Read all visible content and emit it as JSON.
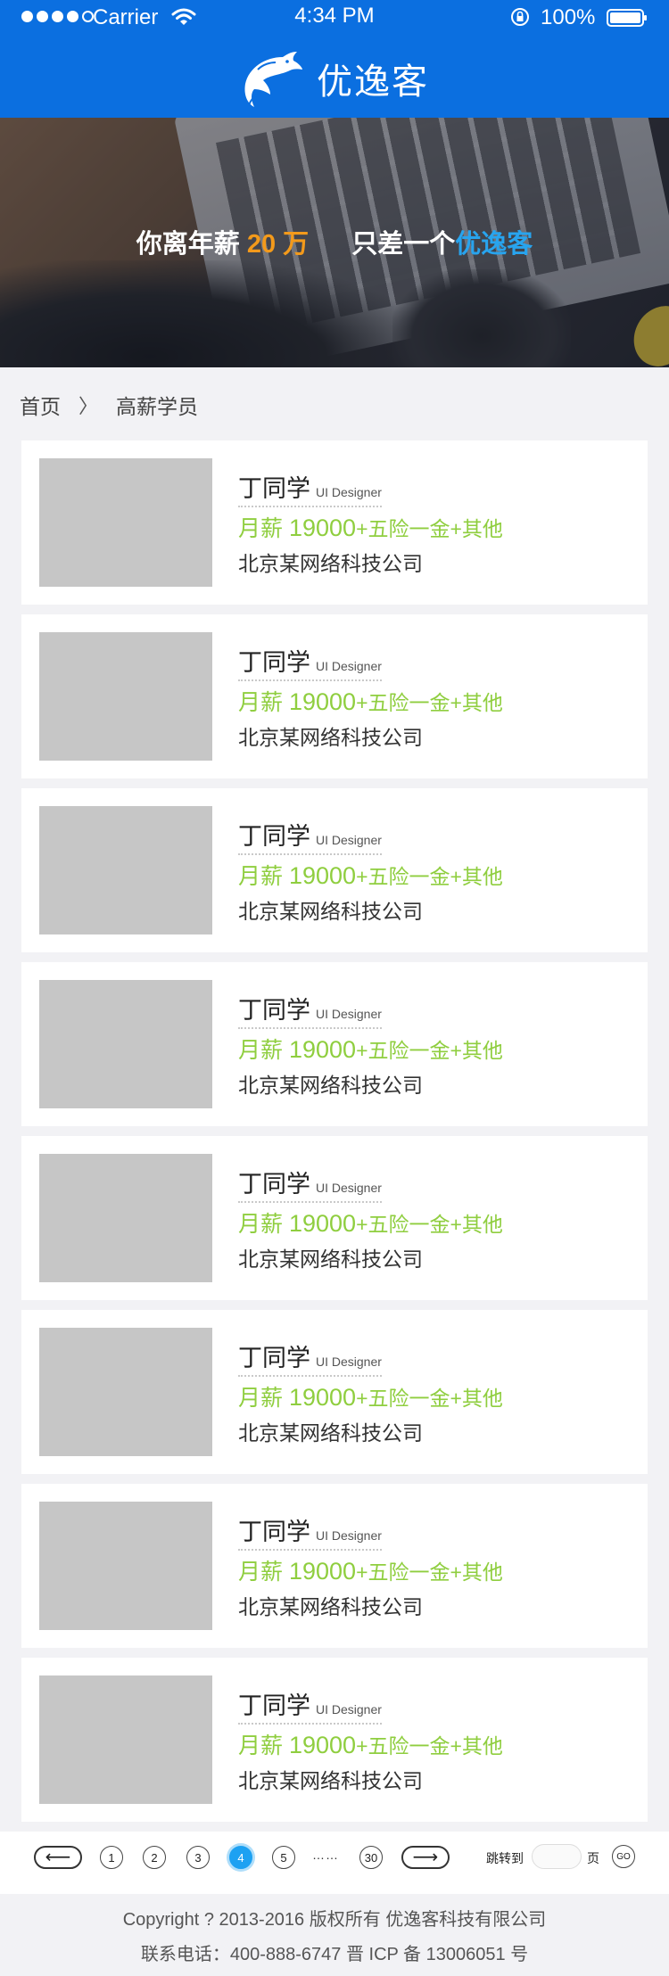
{
  "status_bar": {
    "carrier": "Carrier",
    "time": "4:34 PM",
    "battery": "100%",
    "signal_bars": [
      true,
      true,
      true,
      true,
      false
    ]
  },
  "header": {
    "brand_name": "优逸客",
    "logo_icon": "dolphin-logo-icon",
    "background_color": "#0b6fe0"
  },
  "banner": {
    "text_prefix": "你离年薪",
    "salary": "20 万",
    "text_mid": "只差一个",
    "brand": "优逸客",
    "salary_color": "#f39a1b",
    "brand_color": "#28a4ee"
  },
  "breadcrumb": {
    "home": "首页",
    "separator": "〉",
    "current": "高薪学员"
  },
  "students": [
    {
      "name": "丁同学",
      "role": "UI Designer",
      "salary_label": "月薪",
      "salary_amount": "19000",
      "benefits": "+五险一金+其他",
      "company": "北京某网络科技公司"
    },
    {
      "name": "丁同学",
      "role": "UI Designer",
      "salary_label": "月薪",
      "salary_amount": "19000",
      "benefits": "+五险一金+其他",
      "company": "北京某网络科技公司"
    },
    {
      "name": "丁同学",
      "role": "UI Designer",
      "salary_label": "月薪",
      "salary_amount": "19000",
      "benefits": "+五险一金+其他",
      "company": "北京某网络科技公司"
    },
    {
      "name": "丁同学",
      "role": "UI Designer",
      "salary_label": "月薪",
      "salary_amount": "19000",
      "benefits": "+五险一金+其他",
      "company": "北京某网络科技公司"
    },
    {
      "name": "丁同学",
      "role": "UI Designer",
      "salary_label": "月薪",
      "salary_amount": "19000",
      "benefits": "+五险一金+其他",
      "company": "北京某网络科技公司"
    },
    {
      "name": "丁同学",
      "role": "UI Designer",
      "salary_label": "月薪",
      "salary_amount": "19000",
      "benefits": "+五险一金+其他",
      "company": "北京某网络科技公司"
    },
    {
      "name": "丁同学",
      "role": "UI Designer",
      "salary_label": "月薪",
      "salary_amount": "19000",
      "benefits": "+五险一金+其他",
      "company": "北京某网络科技公司"
    },
    {
      "name": "丁同学",
      "role": "UI Designer",
      "salary_label": "月薪",
      "salary_amount": "19000",
      "benefits": "+五险一金+其他",
      "company": "北京某网络科技公司"
    }
  ],
  "pagination": {
    "prev_arrow": "⟵",
    "next_arrow": "⟶",
    "pages": [
      "1",
      "2",
      "3",
      "4",
      "5"
    ],
    "current_page": "4",
    "ellipsis": "……",
    "last_page": "30",
    "jump_label": "跳转到",
    "jump_value": "",
    "page_label": "页",
    "go_label": "GO",
    "active_color": "#1da1f2"
  },
  "footer": {
    "copyright": "Copyright ? 2013-2016 版权所有 优逸客科技有限公司",
    "contact": "联系电话：400-888-6747 晋 ICP 备 13006051 号"
  }
}
